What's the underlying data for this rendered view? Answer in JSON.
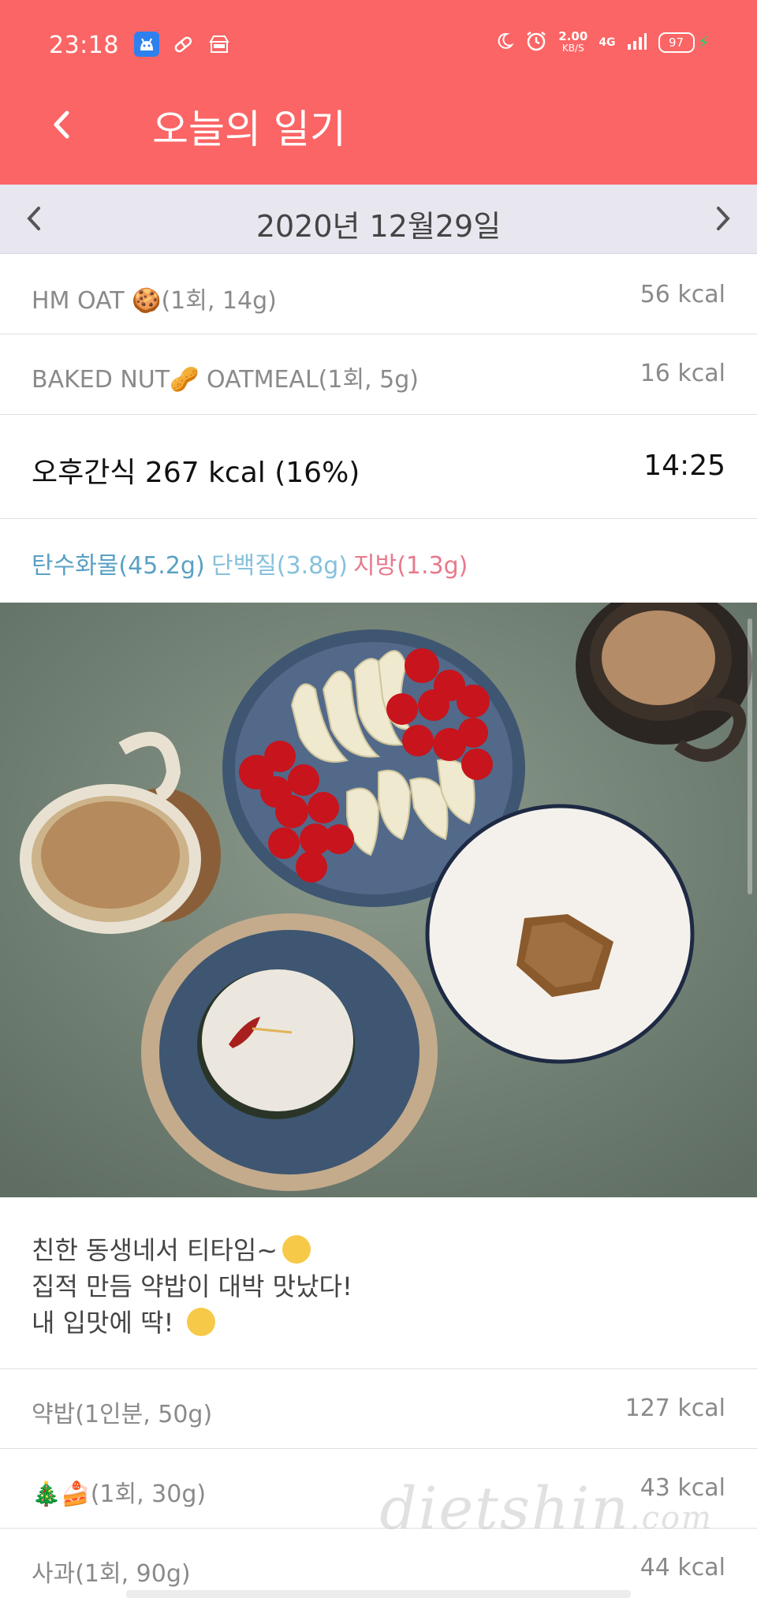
{
  "status_bar": {
    "time": "23:18",
    "net_speed": "2.00",
    "net_unit": "KB/S",
    "network": "4G",
    "battery": "97"
  },
  "header": {
    "title": "오늘의 일기"
  },
  "date_bar": {
    "date": "2020년 12월29일"
  },
  "items_top": [
    {
      "name": "HM OAT 🍪(1회, 14g)",
      "kcal": "56 kcal"
    },
    {
      "name": "BAKED NUT🥜 OATMEAL(1회, 5g)",
      "kcal": "16 kcal"
    }
  ],
  "meal": {
    "title": "오후간식 267 kcal (16%)",
    "time": "14:25"
  },
  "macros": {
    "carb": "탄수화물(45.2g)",
    "protein": "단백질(3.8g)",
    "fat": "지방(1.3g)"
  },
  "memo": {
    "line1": "친한 동생네서 티타임~",
    "line2": "집적 만듬 약밥이 대박 맛났다!",
    "line3": "내 입맛에 딱! "
  },
  "items_bottom": [
    {
      "name": "약밥(1인분, 50g)",
      "kcal": "127 kcal"
    },
    {
      "name": "🎄🍰(1회, 30g)",
      "kcal": "43 kcal"
    },
    {
      "name": "사과(1회, 90g)",
      "kcal": "44 kcal"
    }
  ],
  "watermark": {
    "main": "dietshin",
    "suffix": ".com"
  },
  "colors": {
    "header": "#fb6565",
    "carb": "#5aa0c4",
    "protein": "#86c1db",
    "fat": "#e8798c"
  }
}
